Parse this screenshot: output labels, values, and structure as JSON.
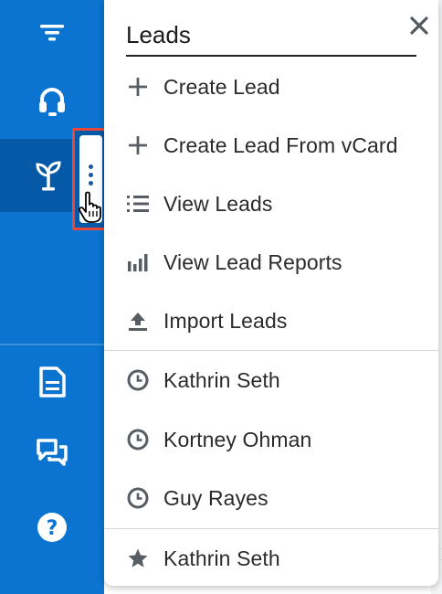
{
  "sidebar": {
    "items": [
      {
        "icon": "funnel-icon"
      },
      {
        "icon": "headset-icon"
      },
      {
        "icon": "sprout-icon",
        "active": true
      },
      {
        "icon": "document-icon"
      },
      {
        "icon": "chat-bubbles-icon"
      },
      {
        "icon": "help-circle-icon"
      }
    ],
    "colors": {
      "background": "#0a74d0",
      "active": "#0559a6",
      "highlight": "#e8483a"
    }
  },
  "menu": {
    "title": "Leads",
    "actions": [
      {
        "label": "Create Lead",
        "icon": "plus-icon"
      },
      {
        "label": "Create Lead From vCard",
        "icon": "plus-icon"
      },
      {
        "label": "View Leads",
        "icon": "list-icon"
      },
      {
        "label": "View Lead Reports",
        "icon": "bar-chart-icon"
      },
      {
        "label": "Import Leads",
        "icon": "upload-icon"
      }
    ],
    "recent": [
      {
        "label": "Kathrin Seth",
        "icon": "clock-icon"
      },
      {
        "label": "Kortney Ohman",
        "icon": "clock-icon"
      },
      {
        "label": "Guy Rayes",
        "icon": "clock-icon"
      }
    ],
    "favorites": [
      {
        "label": "Kathrin Seth",
        "icon": "star-icon"
      }
    ]
  }
}
